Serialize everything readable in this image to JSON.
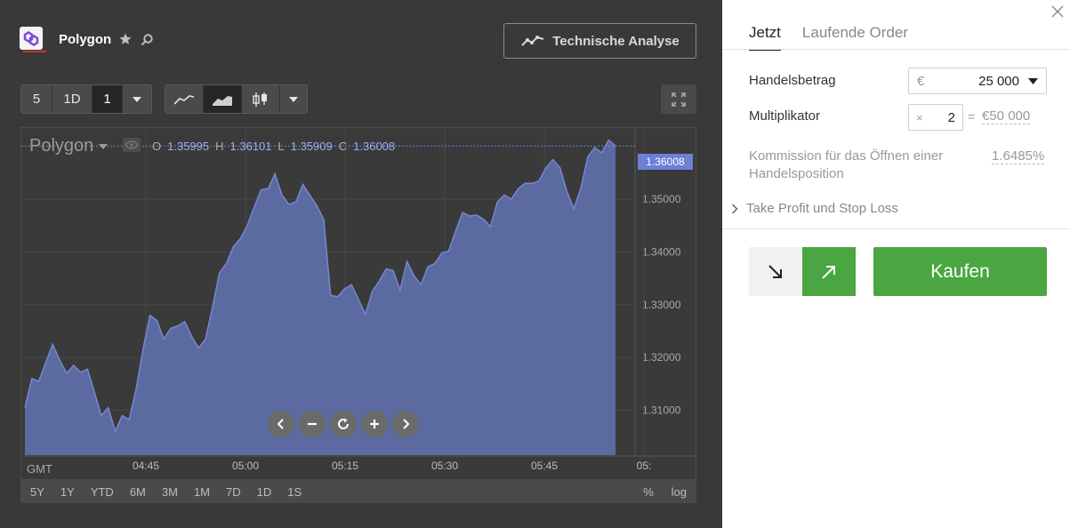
{
  "asset": {
    "name": "Polygon"
  },
  "toolbar": {
    "technical_analysis_label": "Technische Analyse",
    "interval_group": [
      "5",
      "1D",
      "1"
    ],
    "chart_types": [
      "line-chart-icon",
      "area-chart-icon",
      "candlestick-chart-icon"
    ]
  },
  "chart": {
    "symbol": "Polygon",
    "ohlc": [
      {
        "label": "O",
        "value": "1.35995"
      },
      {
        "label": "H",
        "value": "1.36101"
      },
      {
        "label": "L",
        "value": "1.35909"
      },
      {
        "label": "C",
        "value": "1.36008"
      }
    ],
    "current_price_tag": "1.36008",
    "timezone": "GMT",
    "range_buttons": [
      "5Y",
      "1Y",
      "YTD",
      "6M",
      "3M",
      "1M",
      "7D",
      "1D",
      "1S"
    ],
    "scale_buttons": [
      "%",
      "log"
    ]
  },
  "chart_data": {
    "type": "area",
    "y_ticks": [
      "1.35000",
      "1.34000",
      "1.33000",
      "1.32000",
      "1.31000"
    ],
    "x_ticks": [
      "04:45",
      "05:00",
      "05:15",
      "05:30",
      "05:45",
      "05:"
    ],
    "ylim": [
      1.3015,
      1.3635
    ],
    "grid": true,
    "series": [
      {
        "values": [
          1.3105,
          1.316,
          1.3155,
          1.319,
          1.3225,
          1.3195,
          1.317,
          1.3185,
          1.3172,
          1.3178,
          1.3135,
          1.309,
          1.3105,
          1.306,
          1.309,
          1.3082,
          1.314,
          1.3215,
          1.328,
          1.327,
          1.3235,
          1.3255,
          1.326,
          1.3268,
          1.324,
          1.3218,
          1.3235,
          1.3295,
          1.336,
          1.3378,
          1.341,
          1.3425,
          1.345,
          1.3485,
          1.3518,
          1.352,
          1.3548,
          1.3508,
          1.349,
          1.3495,
          1.3528,
          1.3508,
          1.3488,
          1.3462,
          1.3318,
          1.3315,
          1.333,
          1.3338,
          1.331,
          1.3282,
          1.3325,
          1.3345,
          1.3368,
          1.3365,
          1.3328,
          1.3382,
          1.3355,
          1.3338,
          1.3372,
          1.3378,
          1.3398,
          1.3402,
          1.344,
          1.3475,
          1.3468,
          1.347,
          1.3462,
          1.3448,
          1.3495,
          1.3508,
          1.35,
          1.352,
          1.353,
          1.353,
          1.3535,
          1.356,
          1.3575,
          1.356,
          1.3515,
          1.3482,
          1.352,
          1.358,
          1.3598,
          1.3588,
          1.3612,
          1.36008
        ]
      }
    ]
  },
  "trade_panel": {
    "tabs": [
      "Jetzt",
      "Laufende Order"
    ],
    "amount_label": "Handelsbetrag",
    "amount_currency": "€",
    "amount_value": "25 000",
    "multiplier_label": "Multiplikator",
    "multiplier_prefix": "×",
    "multiplier_value": "2",
    "multiplier_eq": "=",
    "multiplier_total": "€50 000",
    "commission_label": "Kommission für das Öffnen einer Handelsposition",
    "commission_value": "1.6485%",
    "tp_sl_label": "Take Profit und Stop Loss",
    "buy_label": "Kaufen"
  },
  "colors": {
    "left_bg": "#393939",
    "area_fill": "#5d6da6",
    "area_line": "#7787d0",
    "buy_green": "#4aa641",
    "price_tag": "#6b80d6"
  }
}
